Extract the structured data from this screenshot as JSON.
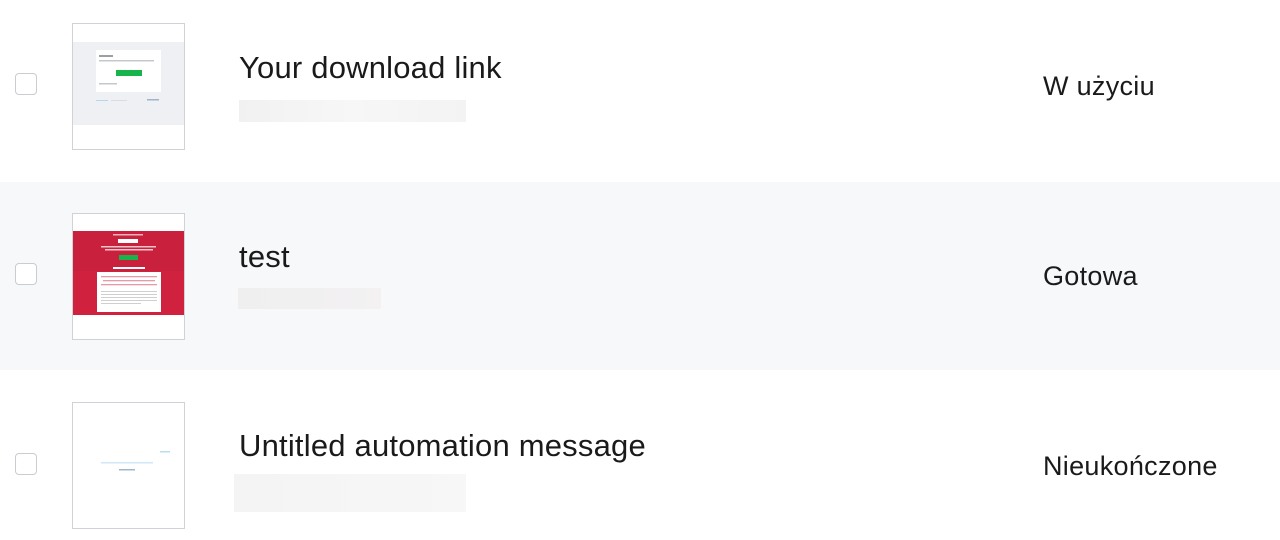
{
  "rows": [
    {
      "title": "Your download link",
      "status": "W użyciu",
      "thumbnail_icon": "email-preview-light-icon",
      "checked": false
    },
    {
      "title": "test",
      "status": "Gotowa",
      "thumbnail_icon": "email-preview-red-icon",
      "checked": false
    },
    {
      "title": "Untitled automation message",
      "status": "Nieukończone",
      "thumbnail_icon": "email-preview-blank-icon",
      "checked": false
    }
  ],
  "colors": {
    "row_alt_background": "#f6f8f9",
    "thumb_red": "#d0213e",
    "thumb_button_green": "#17b44b",
    "text": "#1a1a1a",
    "checkbox_border": "#c9ccd0"
  }
}
